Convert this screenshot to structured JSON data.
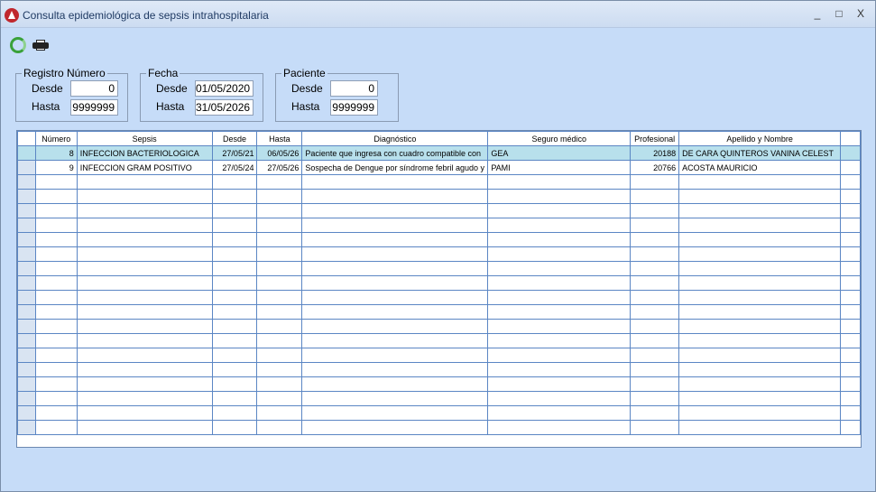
{
  "window": {
    "title": "Consulta epidemiológica de sepsis intrahospitalaria",
    "minimize": "_",
    "maximize": "□",
    "close": "X"
  },
  "toolbar": {
    "refresh_icon": "refresh-icon",
    "print_icon": "printer-icon"
  },
  "filters": {
    "registro": {
      "legend": "Registro Número",
      "desde_label": "Desde",
      "hasta_label": "Hasta",
      "desde": "0",
      "hasta": "9999999"
    },
    "fecha": {
      "legend": "Fecha",
      "desde_label": "Desde",
      "hasta_label": "Hasta",
      "desde": "01/05/2020",
      "hasta": "31/05/2026"
    },
    "paciente": {
      "legend": "Paciente",
      "desde_label": "Desde",
      "hasta_label": "Hasta",
      "desde": "0",
      "hasta": "9999999"
    }
  },
  "grid": {
    "columns": [
      "Número",
      "Sepsis",
      "Desde",
      "Hasta",
      "Diagnóstico",
      "Seguro médico",
      "Profesional",
      "Apellido y Nombre"
    ],
    "rows": [
      [
        "8",
        "INFECCION BACTERIOLOGICA",
        "27/05/21",
        "06/05/26",
        "Paciente que ingresa con cuadro compatible con",
        "GEA",
        "20188",
        "DE CARA QUINTEROS VANINA CELEST"
      ],
      [
        "9",
        "INFECCION GRAM POSITIVO",
        "27/05/24",
        "27/05/26",
        "Sospecha de Dengue por síndrome febril agudo y",
        "PAMI",
        "20766",
        "ACOSTA MAURICIO"
      ]
    ]
  },
  "colors": {
    "window_bg": "#c6dcf8",
    "selected_row": "#b8e0ec",
    "grid_line": "#5b86c4"
  }
}
